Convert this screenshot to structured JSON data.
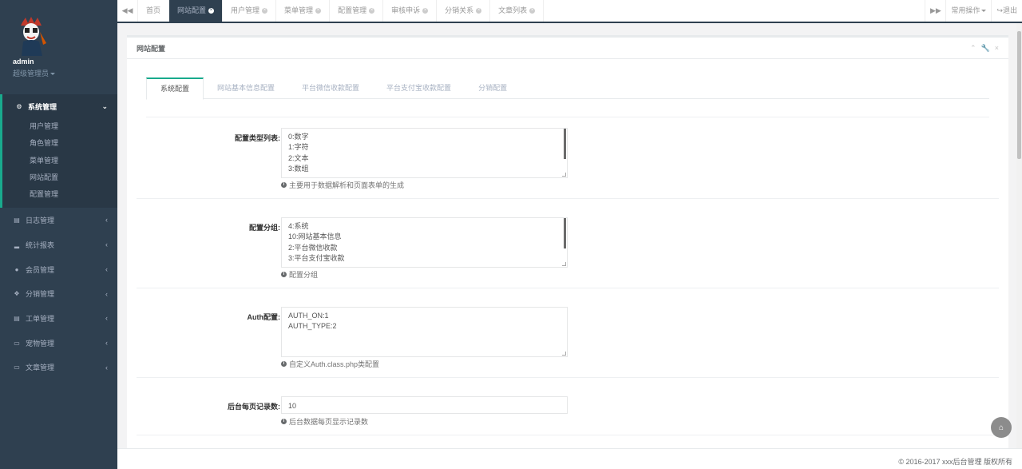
{
  "user": {
    "name": "admin",
    "role": "超级管理员"
  },
  "sidebar": {
    "active_group": {
      "icon": "gear-icon",
      "label": "系统管理",
      "items": [
        "用户管理",
        "角色管理",
        "菜单管理",
        "网站配置",
        "配置管理"
      ]
    },
    "groups": [
      {
        "icon": "list-icon",
        "label": "日志管理"
      },
      {
        "icon": "bar-chart-icon",
        "label": "统计报表"
      },
      {
        "icon": "user-icon",
        "label": "会员管理"
      },
      {
        "icon": "cubes-icon",
        "label": "分销管理"
      },
      {
        "icon": "list-icon",
        "label": "工单管理"
      },
      {
        "icon": "book-icon",
        "label": "宠物管理"
      },
      {
        "icon": "book-icon",
        "label": "文章管理"
      }
    ]
  },
  "tabs": [
    {
      "label": "首页",
      "closable": false,
      "active": false
    },
    {
      "label": "网站配置",
      "closable": true,
      "active": true
    },
    {
      "label": "用户管理",
      "closable": true,
      "active": false
    },
    {
      "label": "菜单管理",
      "closable": true,
      "active": false
    },
    {
      "label": "配置管理",
      "closable": true,
      "active": false
    },
    {
      "label": "审核申诉",
      "closable": true,
      "active": false
    },
    {
      "label": "分销关系",
      "closable": true,
      "active": false
    },
    {
      "label": "文章列表",
      "closable": true,
      "active": false
    }
  ],
  "topbar": {
    "common_ops": "常用操作",
    "logout": "退出"
  },
  "panel": {
    "title": "网站配置"
  },
  "form_tabs": [
    "系统配置",
    "网站基本信息配置",
    "平台微信收款配置",
    "平台支付宝收款配置",
    "分销配置"
  ],
  "form": {
    "type_list": {
      "label": "配置类型列表:",
      "lines": [
        "0:数字",
        "1:字符",
        "2:文本",
        "3:数组"
      ],
      "help": "主要用于数据解析和页面表单的生成"
    },
    "group": {
      "label": "配置分组:",
      "lines": [
        "4:系统",
        "10:网站基本信息",
        "2:平台微信收款",
        "3:平台支付宝收款"
      ],
      "help": "配置分组"
    },
    "auth": {
      "label": "Auth配置:",
      "lines": [
        "AUTH_ON:1",
        "AUTH_TYPE:2"
      ],
      "help": "自定义Auth.class.php类配置"
    },
    "page_size": {
      "label": "后台每页记录数:",
      "value": "10",
      "help": "后台数据每页显示记录数"
    }
  },
  "footer": {
    "copyright": "© 2016-2017 xxx后台管理 版权所有"
  },
  "colors": {
    "sidebar_bg": "#2f4050",
    "accent": "#19aa8d"
  }
}
